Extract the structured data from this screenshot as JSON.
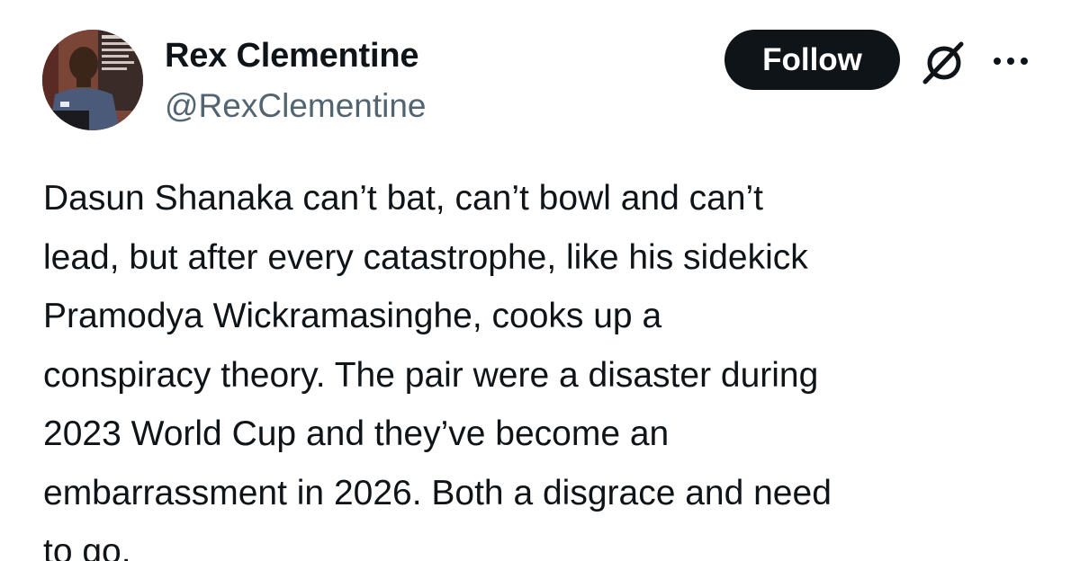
{
  "author": {
    "name": "Rex Clementine",
    "handle": "@RexClementine"
  },
  "actions": {
    "follow_label": "Follow",
    "grok_icon": "grok-icon",
    "more_icon": "more-options-icon"
  },
  "tweet": {
    "lines": [
      "Dasun Shanaka can’t bat, can’t bowl and can’t",
      "lead, but after every catastrophe, like his sidekick",
      "Pramodya Wickramasinghe, cooks up a",
      "conspiracy theory. The pair were a disaster during",
      "2023 World Cup and they’ve become an",
      "embarrassment in 2026. Both a disgrace and need",
      "to go."
    ]
  },
  "colors": {
    "text": "#0f1419",
    "secondary": "#536471",
    "button_bg": "#0f1419",
    "button_text": "#ffffff"
  }
}
